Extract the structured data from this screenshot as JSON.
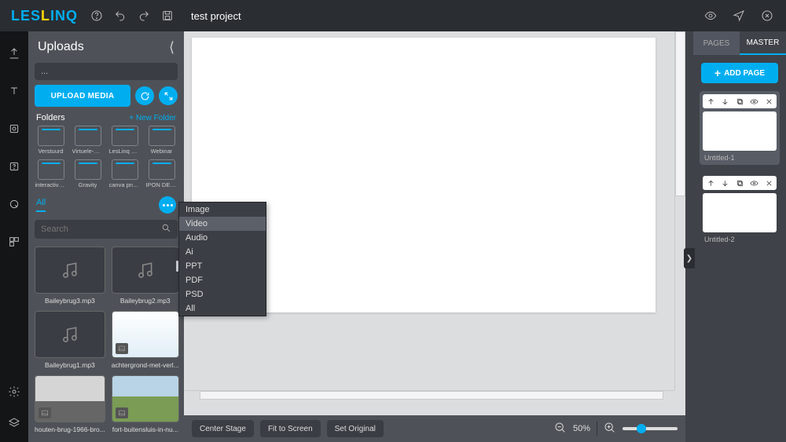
{
  "header": {
    "project_title": "test project",
    "top_icons": [
      "help",
      "undo",
      "redo",
      "save"
    ],
    "right_icons": [
      "preview",
      "send",
      "close"
    ]
  },
  "rail": {
    "items": [
      "upload",
      "text",
      "shapes",
      "help",
      "pointer",
      "widgets"
    ],
    "bottom": [
      "settings",
      "layers"
    ]
  },
  "uploads": {
    "title": "Uploads",
    "breadcrumb": "...",
    "upload_label": "UPLOAD MEDIA",
    "folders_label": "Folders",
    "new_folder_label": "+ New Folder",
    "folders": [
      "Verstuurd",
      "Virtuele-Det...",
      "LesLinq Pro...",
      "Webinar",
      "interactive ...",
      "Gravity",
      "canva png t...",
      "IPON DEMO"
    ],
    "tabs": {
      "all": "All"
    },
    "search_placeholder": "Search",
    "media": [
      {
        "name": "Baileybrug3.mp3",
        "kind": "music"
      },
      {
        "name": "Baileybrug2.mp3",
        "kind": "music"
      },
      {
        "name": "Baileybrug1.mp3",
        "kind": "music"
      },
      {
        "name": "achtergrond-met-verl...",
        "kind": "image",
        "thumb": "a"
      },
      {
        "name": "houten-brug-1966-bro...",
        "kind": "image",
        "thumb": "b"
      },
      {
        "name": "fort-buitensluis-in-nu...",
        "kind": "image",
        "thumb": "c"
      }
    ]
  },
  "filter_menu": {
    "items": [
      "Image",
      "Video",
      "Audio",
      "Ai",
      "PPT",
      "PDF",
      "PSD",
      "All"
    ],
    "highlighted": "Video",
    "marked": "PPT"
  },
  "canvas_bar": {
    "center_stage": "Center Stage",
    "fit_screen": "Fit to Screen",
    "set_original": "Set Original",
    "zoom_value": "50%"
  },
  "pages": {
    "tab_pages": "PAGES",
    "tab_master": "MASTER",
    "add_page": "ADD PAGE",
    "items": [
      "Untitled-1",
      "Untitled-2"
    ]
  }
}
